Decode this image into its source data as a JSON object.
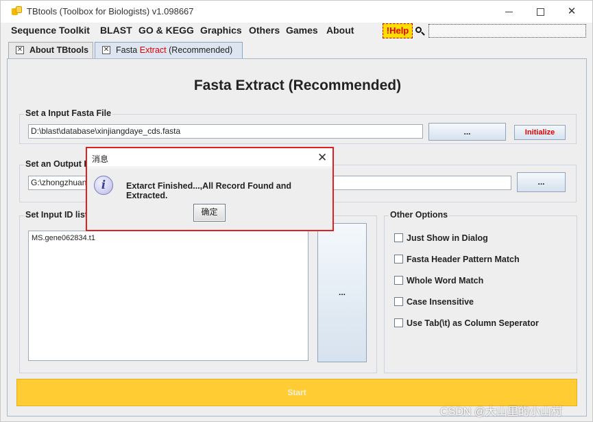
{
  "window": {
    "title": "TBtools (Toolbox for Biologists) v1.098667",
    "min_label": "",
    "close_label": "✕"
  },
  "menu": {
    "items": [
      "Sequence Toolkit",
      "BLAST",
      "GO & KEGG",
      "Graphics",
      "Others",
      "Games",
      "About"
    ],
    "help_label": "!Help",
    "search_value": ""
  },
  "tabs": [
    {
      "label": "About TBtools"
    },
    {
      "label_pre": "Fasta ",
      "label_red": "Extract",
      "label_post": " (Recommended)"
    }
  ],
  "page": {
    "title": "Fasta Extract (Recommended)",
    "input_group": {
      "label": "Set a Input Fasta File",
      "value": "D:\\blast\\database\\xinjiangdaye_cds.fasta",
      "browse_label": "...",
      "initialize_label": "Initialize"
    },
    "output_group": {
      "label": "Set an Output Fa",
      "value": "G:\\zhongzhuan",
      "browse_label": "..."
    },
    "id_group": {
      "label": "Set Input ID list",
      "value": "MS.gene062834.t1",
      "browse_label": "..."
    },
    "options": {
      "label": "Other Options",
      "items": [
        {
          "label": "Just Show in Dialog",
          "checked": false
        },
        {
          "label": "Fasta Header Pattern Match",
          "checked": false
        },
        {
          "label": "Whole Word Match",
          "checked": false
        },
        {
          "label": "Case Insensitive",
          "checked": false
        },
        {
          "label": "Use Tab(\\t) as Column Seperator",
          "checked": false
        }
      ]
    },
    "start_label": "Start"
  },
  "dialog": {
    "title": "消息",
    "message": "Extarct Finished...,All Record Found and Extracted.",
    "ok_label": "确定",
    "close_label": "✕"
  },
  "watermark": "CSDN @大山里的小山村",
  "colors": {
    "accent_red": "#e00000",
    "start_yellow": "#ffcc33",
    "help_yellow": "#ffdd00",
    "dialog_border": "#e02020"
  }
}
